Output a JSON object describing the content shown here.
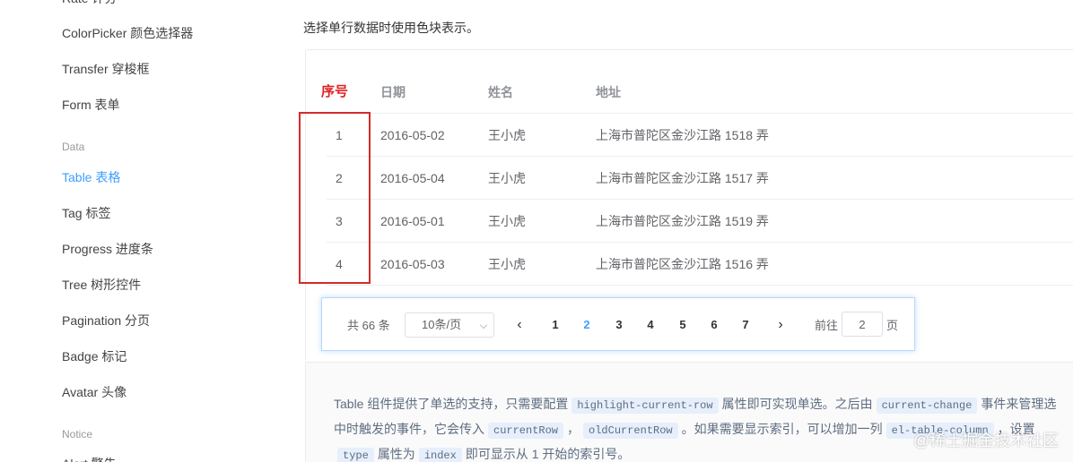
{
  "sidebar": {
    "clipped_top_label": "Rate 评分",
    "items_form": [
      {
        "label": "ColorPicker 颜色选择器"
      },
      {
        "label": "Transfer 穿梭框"
      },
      {
        "label": "Form 表单"
      }
    ],
    "group_data": "Data",
    "items_data": [
      {
        "label": "Table 表格",
        "active": true
      },
      {
        "label": "Tag 标签"
      },
      {
        "label": "Progress 进度条"
      },
      {
        "label": "Tree 树形控件"
      },
      {
        "label": "Pagination 分页"
      },
      {
        "label": "Badge 标记"
      },
      {
        "label": "Avatar 头像"
      }
    ],
    "group_notice": "Notice",
    "clipped_bottom_label": "Alert 警告"
  },
  "intro_text": "选择单行数据时使用色块表示。",
  "table": {
    "headers": [
      "序号",
      "日期",
      "姓名",
      "地址"
    ],
    "rows": [
      {
        "index": "1",
        "date": "2016-05-02",
        "name": "王小虎",
        "address": "上海市普陀区金沙江路 1518 弄"
      },
      {
        "index": "2",
        "date": "2016-05-04",
        "name": "王小虎",
        "address": "上海市普陀区金沙江路 1517 弄"
      },
      {
        "index": "3",
        "date": "2016-05-01",
        "name": "王小虎",
        "address": "上海市普陀区金沙江路 1519 弄"
      },
      {
        "index": "4",
        "date": "2016-05-03",
        "name": "王小虎",
        "address": "上海市普陀区金沙江路 1516 弄"
      }
    ]
  },
  "pagination": {
    "total_text": "共 66 条",
    "page_size_text": "10条/页",
    "prev_icon": "‹",
    "next_icon": "›",
    "pages": [
      "1",
      "2",
      "3",
      "4",
      "5",
      "6",
      "7"
    ],
    "current_page": "2",
    "goto_label": "前往",
    "goto_value": "2",
    "goto_suffix": "页"
  },
  "description": {
    "t1": "Table 组件提供了单选的支持，只需要配置",
    "c1": "highlight-current-row",
    "t2": "属性即可实现单选。之后由",
    "c2": "current-change",
    "t3": "事件来管理选中时触发的事件，它会传入",
    "c3": "currentRow",
    "t4": "，",
    "c4": "oldCurrentRow",
    "t5": "。如果需要显示索引，可以增加一列",
    "c5": "el-table-column",
    "t6": "，设置",
    "c6": "type",
    "t7": "属性为",
    "c7": "index",
    "t8": "即可显示从 1 开始的索引号。"
  },
  "watermark": "@稀土掘金技术社区",
  "colors": {
    "accent": "#409eff",
    "highlight_box": "#d52a2a",
    "header_index": "#e02020"
  }
}
